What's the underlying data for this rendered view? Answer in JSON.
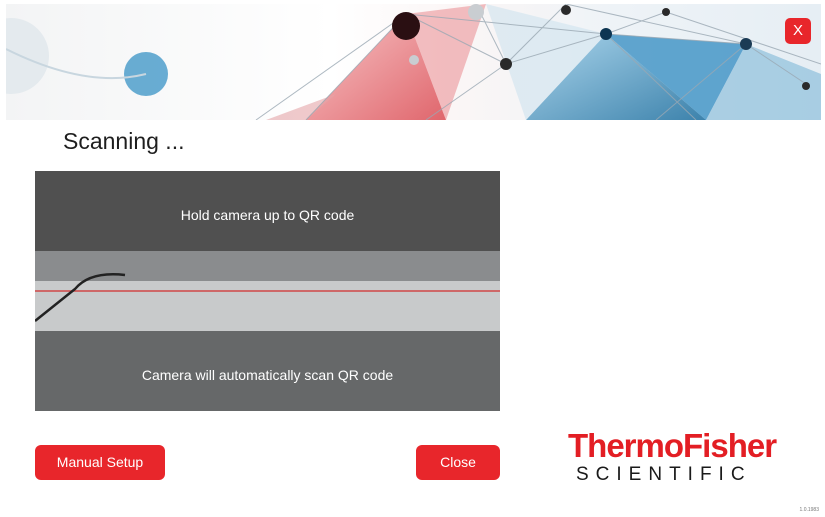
{
  "dialog": {
    "title": "Scanning ...",
    "close_icon_label": "X"
  },
  "camera": {
    "instruction_top": "Hold camera up to QR code",
    "instruction_bottom": "Camera will automatically scan QR code"
  },
  "buttons": {
    "manual_setup": "Manual Setup",
    "close": "Close"
  },
  "logo": {
    "name": "ThermoFisher",
    "subtitle": "SCIENTIFIC"
  },
  "footer": {
    "version": "1.0.1983"
  },
  "colors": {
    "accent": "#e8262b",
    "logo_red": "#e31e24",
    "banner_blue": "#1e7fb5",
    "banner_red": "#d9424a"
  },
  "icons": [
    "close-icon"
  ]
}
